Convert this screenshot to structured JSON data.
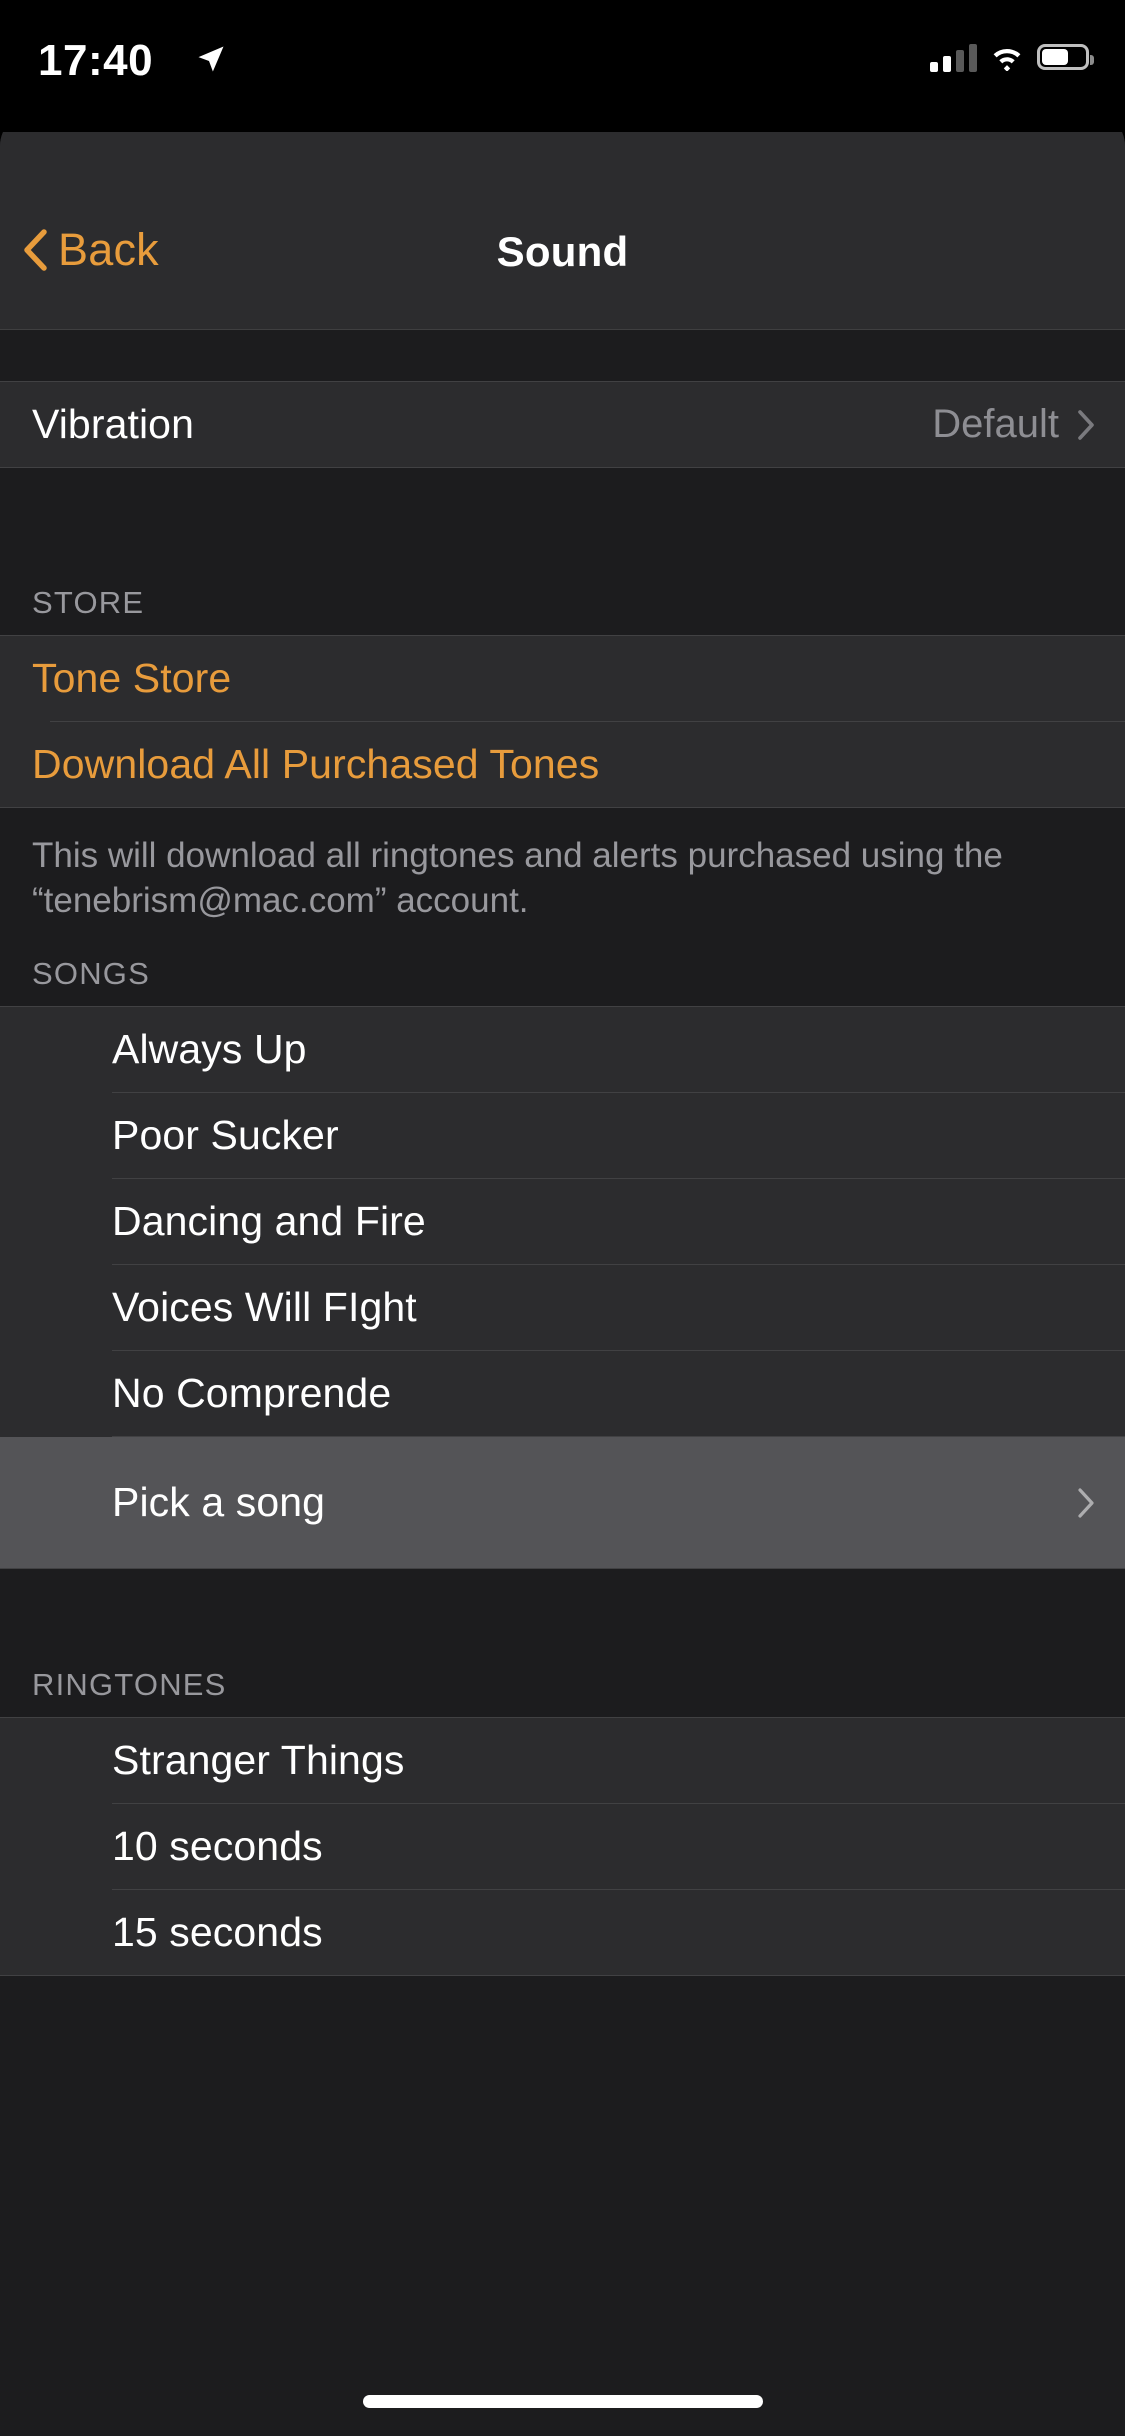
{
  "status_bar": {
    "time": "17:40",
    "location_icon": "location-arrow-icon",
    "cellular_icon": "cellular-bars-icon",
    "wifi_icon": "wifi-icon",
    "battery_icon": "battery-icon"
  },
  "nav": {
    "back_label": "Back",
    "back_icon": "chevron-left-icon",
    "title": "Sound"
  },
  "vibration": {
    "label": "Vibration",
    "value": "Default",
    "chevron_icon": "chevron-right-icon"
  },
  "store": {
    "header": "STORE",
    "items": [
      {
        "label": "Tone Store"
      },
      {
        "label": "Download All Purchased Tones"
      }
    ],
    "footer": "This will download all ringtones and alerts purchased using the “tenebrism@mac.com” account."
  },
  "songs": {
    "header": "SONGS",
    "items": [
      {
        "label": "Always Up",
        "selected": false,
        "chevron": false
      },
      {
        "label": "Poor Sucker",
        "selected": false,
        "chevron": false
      },
      {
        "label": "Dancing and Fire",
        "selected": false,
        "chevron": false
      },
      {
        "label": "Voices Will FIght",
        "selected": false,
        "chevron": false
      },
      {
        "label": "No Comprende",
        "selected": false,
        "chevron": false
      },
      {
        "label": "Pick a song",
        "selected": true,
        "chevron": true
      }
    ]
  },
  "ringtones": {
    "header": "RINGTONES",
    "items": [
      {
        "label": "Stranger Things"
      },
      {
        "label": "10 seconds"
      },
      {
        "label": "15 seconds"
      }
    ]
  },
  "colors": {
    "accent": "#e89c3c",
    "row_bg": "#2c2c2e",
    "group_bg": "#1c1c1e",
    "highlight_bg": "#545457",
    "secondary_text": "#98989d"
  }
}
